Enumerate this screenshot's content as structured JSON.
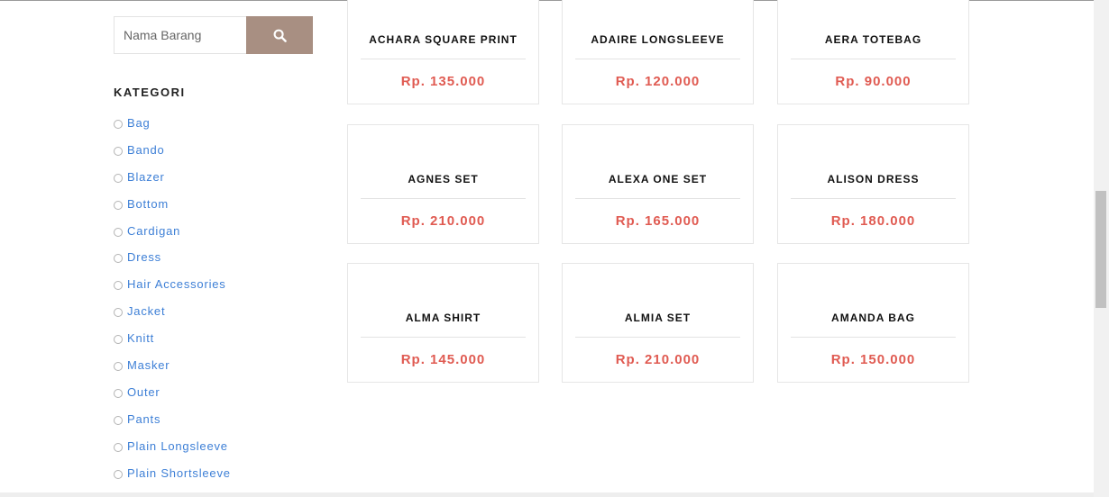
{
  "search": {
    "placeholder": "Nama Barang",
    "button_icon": "search-icon",
    "button_color": "#a88f82"
  },
  "categories": {
    "title": "KATEGORI",
    "items": [
      {
        "label": "Bag"
      },
      {
        "label": "Bando"
      },
      {
        "label": "Blazer"
      },
      {
        "label": "Bottom"
      },
      {
        "label": "Cardigan"
      },
      {
        "label": "Dress"
      },
      {
        "label": "Hair Accessories"
      },
      {
        "label": "Jacket"
      },
      {
        "label": "Knitt"
      },
      {
        "label": "Masker"
      },
      {
        "label": "Outer"
      },
      {
        "label": "Pants"
      },
      {
        "label": "Plain Longsleeve"
      },
      {
        "label": "Plain Shortsleeve"
      }
    ]
  },
  "products": [
    {
      "name": "ACHARA SQUARE PRINT",
      "price": "Rp. 135.000"
    },
    {
      "name": "ADAIRE LONGSLEEVE",
      "price": "Rp. 120.000"
    },
    {
      "name": "AERA TOTEBAG",
      "price": "Rp. 90.000"
    },
    {
      "name": "AGNES SET",
      "price": "Rp. 210.000"
    },
    {
      "name": "ALEXA ONE SET",
      "price": "Rp. 165.000"
    },
    {
      "name": "ALISON DRESS",
      "price": "Rp. 180.000"
    },
    {
      "name": "ALMA SHIRT",
      "price": "Rp. 145.000"
    },
    {
      "name": "ALMIA SET",
      "price": "Rp. 210.000"
    },
    {
      "name": "AMANDA BAG",
      "price": "Rp. 150.000"
    }
  ],
  "colors": {
    "price": "#e05b52",
    "category_link": "#3d7fd6"
  }
}
